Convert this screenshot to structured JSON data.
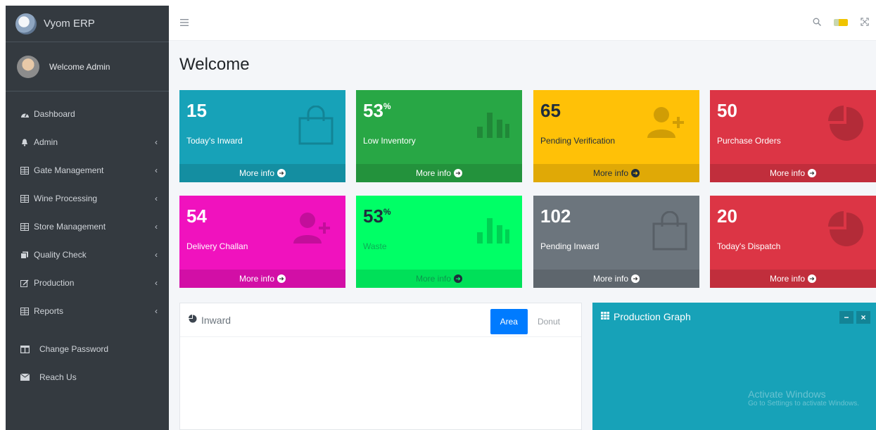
{
  "brand": {
    "name": "Vyom ERP"
  },
  "user": {
    "welcome": "Welcome Admin"
  },
  "sidebar": {
    "items": [
      {
        "label": "Dashboard",
        "icon": "tachometer-icon",
        "has_submenu": false
      },
      {
        "label": "Admin",
        "icon": "bell-icon",
        "has_submenu": true
      },
      {
        "label": "Gate Management",
        "icon": "table-icon",
        "has_submenu": true
      },
      {
        "label": "Wine Processing",
        "icon": "table-icon",
        "has_submenu": true
      },
      {
        "label": "Store Management",
        "icon": "table-icon",
        "has_submenu": true
      },
      {
        "label": "Quality Check",
        "icon": "copy-icon",
        "has_submenu": true
      },
      {
        "label": "Production",
        "icon": "edit-icon",
        "has_submenu": true
      },
      {
        "label": "Reports",
        "icon": "table-icon",
        "has_submenu": true
      }
    ],
    "bottom_items": [
      {
        "label": "Change Password",
        "icon": "columns-icon"
      },
      {
        "label": "Reach Us",
        "icon": "envelope-icon"
      }
    ]
  },
  "topbar": {
    "icons": [
      "menu-icon",
      "search-icon",
      "flag-icon",
      "fullscreen-icon"
    ]
  },
  "page": {
    "title": "Welcome"
  },
  "boxes": [
    {
      "value": "15",
      "suffix": "",
      "label": "Today's Inward",
      "more": "More info",
      "color": "#17a2b8",
      "icon": "shopping-bag-icon"
    },
    {
      "value": "53",
      "suffix": "%",
      "label": "Low Inventory",
      "more": "More info",
      "color": "#28a745",
      "icon": "bar-chart-icon"
    },
    {
      "value": "65",
      "suffix": "",
      "label": "Pending Verification",
      "more": "More info",
      "color": "#ffc107",
      "icon": "user-plus-icon"
    },
    {
      "value": "50",
      "suffix": "",
      "label": "Purchase Orders",
      "more": "More info",
      "color": "#dc3545",
      "icon": "pie-chart-icon"
    },
    {
      "value": "54",
      "suffix": "",
      "label": "Delivery Challan",
      "more": "More info",
      "color": "#f012be",
      "icon": "user-plus-icon"
    },
    {
      "value": "53",
      "suffix": "%",
      "label": "Waste",
      "more": "More info",
      "color": "#00ff66",
      "icon": "bar-chart-icon"
    },
    {
      "value": "102",
      "suffix": "",
      "label": "Pending Inward",
      "more": "More info",
      "color": "#6c757d",
      "icon": "shopping-bag-icon"
    },
    {
      "value": "20",
      "suffix": "",
      "label": "Today's Dispatch",
      "more": "More info",
      "color": "#dc3545",
      "icon": "pie-chart-icon"
    }
  ],
  "inward_card": {
    "title": "Inward",
    "tabs": [
      {
        "label": "Area",
        "active": true
      },
      {
        "label": "Donut",
        "active": false
      }
    ]
  },
  "production_card": {
    "title": "Production Graph",
    "tools": [
      "minimize-icon",
      "close-icon"
    ]
  },
  "watermark": {
    "line1": "Activate Windows",
    "line2": "Go to Settings to activate Windows."
  }
}
